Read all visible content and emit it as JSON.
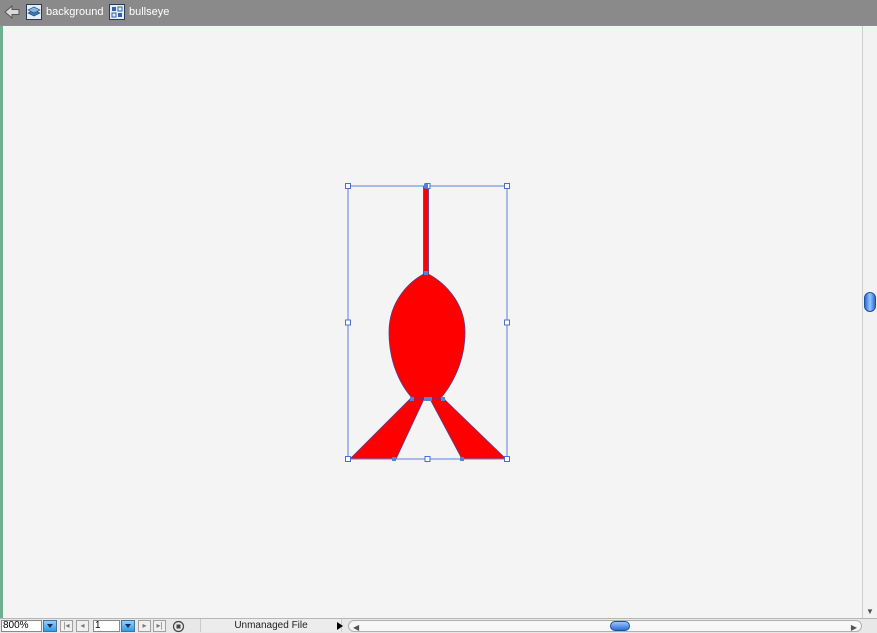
{
  "breadcrumb": {
    "items": [
      {
        "label": "background",
        "icon": "layer-stack-icon"
      },
      {
        "label": "bullseye",
        "icon": "symbol-icon"
      }
    ]
  },
  "canvas": {
    "shape_color": "#ff0000",
    "selection_color": "#5b7fd6"
  },
  "statusbar": {
    "zoom": "800%",
    "page": "1",
    "file_status": "Unmanaged File"
  }
}
